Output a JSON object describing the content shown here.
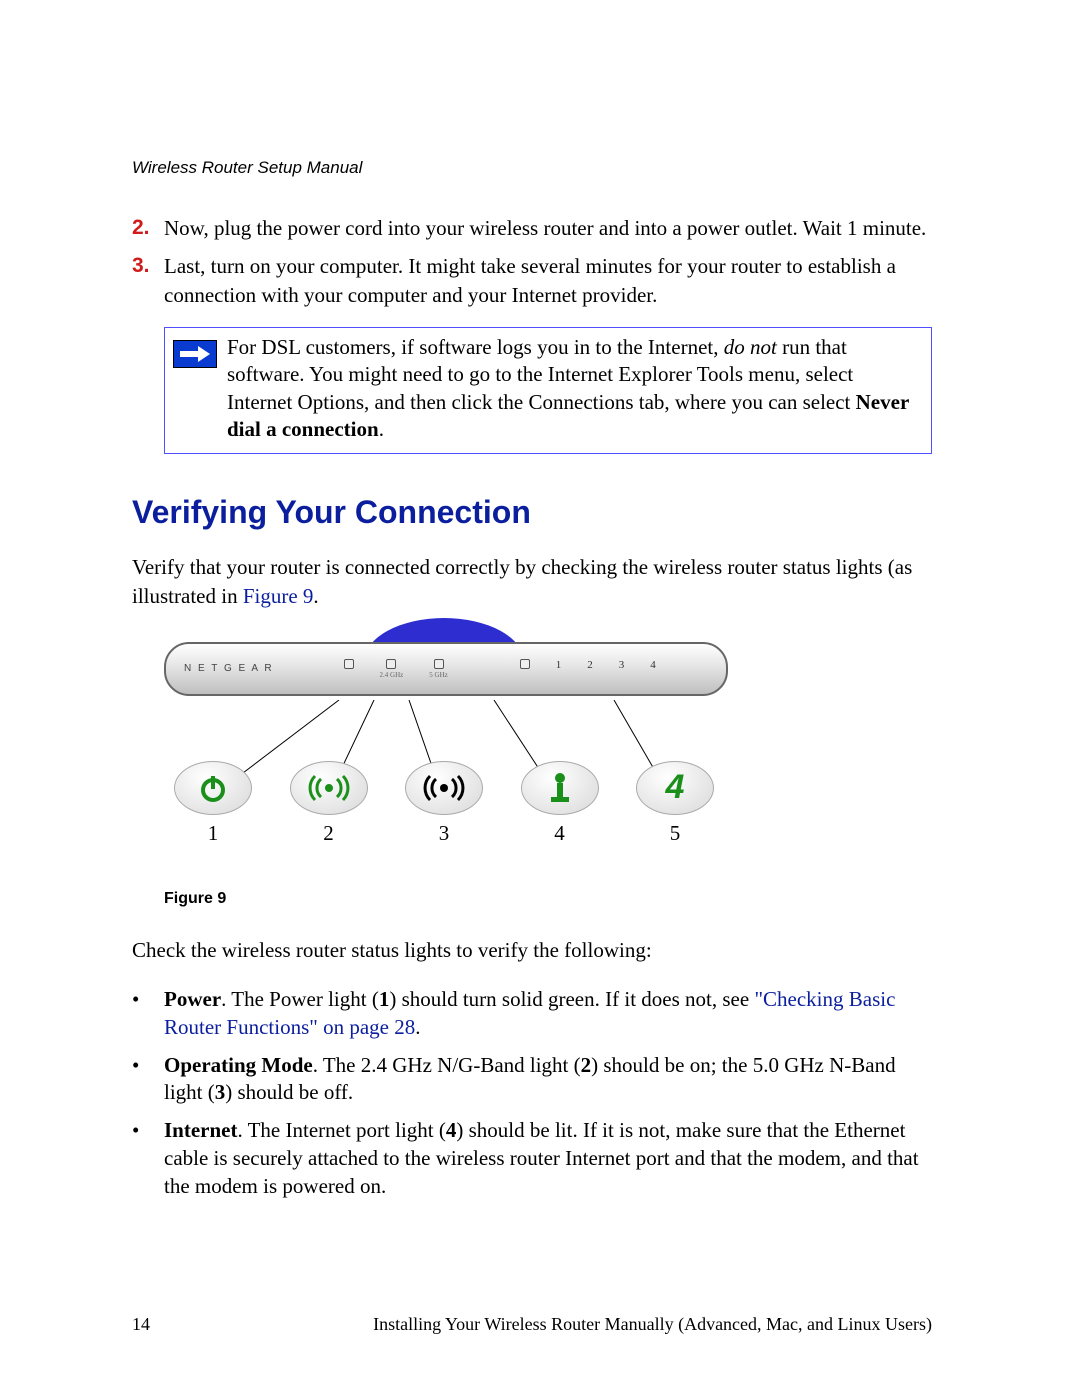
{
  "doc_title": "Wireless Router Setup Manual",
  "steps": {
    "s2": {
      "num": "2.",
      "text": "Now, plug the power cord into your wireless router and into a power outlet. Wait 1 minute."
    },
    "s3": {
      "num": "3.",
      "text": "Last, turn on your computer. It might take several minutes for your router to establish a connection with your computer and your Internet provider."
    }
  },
  "note": {
    "pre": "For DSL customers, if software logs you in to the Internet, ",
    "italic": "do not",
    "post": " run that software. You might need to go to the Internet Explorer Tools menu, select Internet Options, and then click the Connections tab, where you can select ",
    "bold": "Never dial a connection",
    "end": "."
  },
  "heading": "Verifying Your Connection",
  "intro": {
    "pre": "Verify that your router is connected correctly by checking the wireless router status lights (as illustrated in ",
    "link": "Figure 9",
    "post": "."
  },
  "router": {
    "brand": "N E T G E A R",
    "cols": [
      {
        "top": "⏻",
        "sub": ""
      },
      {
        "top": "∘•∘",
        "sub": "2.4 GHz"
      },
      {
        "top": "(•)",
        "sub": "5 GHz"
      },
      {
        "top": "",
        "sub": ""
      },
      {
        "top": "ⓘ",
        "sub": ""
      },
      {
        "top": "1",
        "sub": ""
      },
      {
        "top": "2",
        "sub": ""
      },
      {
        "top": "3",
        "sub": ""
      },
      {
        "top": "4",
        "sub": ""
      }
    ]
  },
  "leds": {
    "l1_num": "1",
    "l2_num": "2",
    "l3_num": "3",
    "l4_num": "4",
    "l5_num": "5",
    "l5_glyph": "4"
  },
  "fig_caption": "Figure 9",
  "check_intro": "Check the wireless router status lights to verify the following:",
  "bullets": {
    "b1": {
      "lead": "Power",
      "mid1": ". The Power light (",
      "n": "1",
      "mid2": ") should turn solid green. If it does not, see ",
      "link": "\"Checking Basic Router Functions\" on page 28",
      "post": "."
    },
    "b2": {
      "lead": "Operating Mode",
      "mid1": ". The 2.4 GHz N/G-Band light (",
      "n1": "2",
      "mid2": ") should be on; the 5.0 GHz N-Band light (",
      "n2": "3",
      "post": ") should be off."
    },
    "b3": {
      "lead": "Internet",
      "mid1": ". The Internet port light (",
      "n": "4",
      "post": ") should be lit. If it is not, make sure that the Ethernet cable is securely attached to the wireless router Internet port and that the modem, and that the modem is powered on."
    }
  },
  "footer": {
    "page": "14",
    "chapter": "Installing Your Wireless Router Manually (Advanced, Mac, and Linux Users)"
  }
}
